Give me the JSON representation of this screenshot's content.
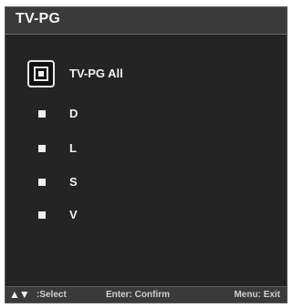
{
  "window": {
    "title": "TV-PG"
  },
  "menu": {
    "items": [
      {
        "label": "TV-PG All",
        "selected": true
      },
      {
        "label": "D",
        "selected": false
      },
      {
        "label": "L",
        "selected": false
      },
      {
        "label": "S",
        "selected": false
      },
      {
        "label": "V",
        "selected": false
      }
    ]
  },
  "footer": {
    "arrows": "▲▼",
    "select_label": ":Select",
    "enter_label": "Enter: Confirm",
    "menu_label": "Menu: Exit"
  }
}
